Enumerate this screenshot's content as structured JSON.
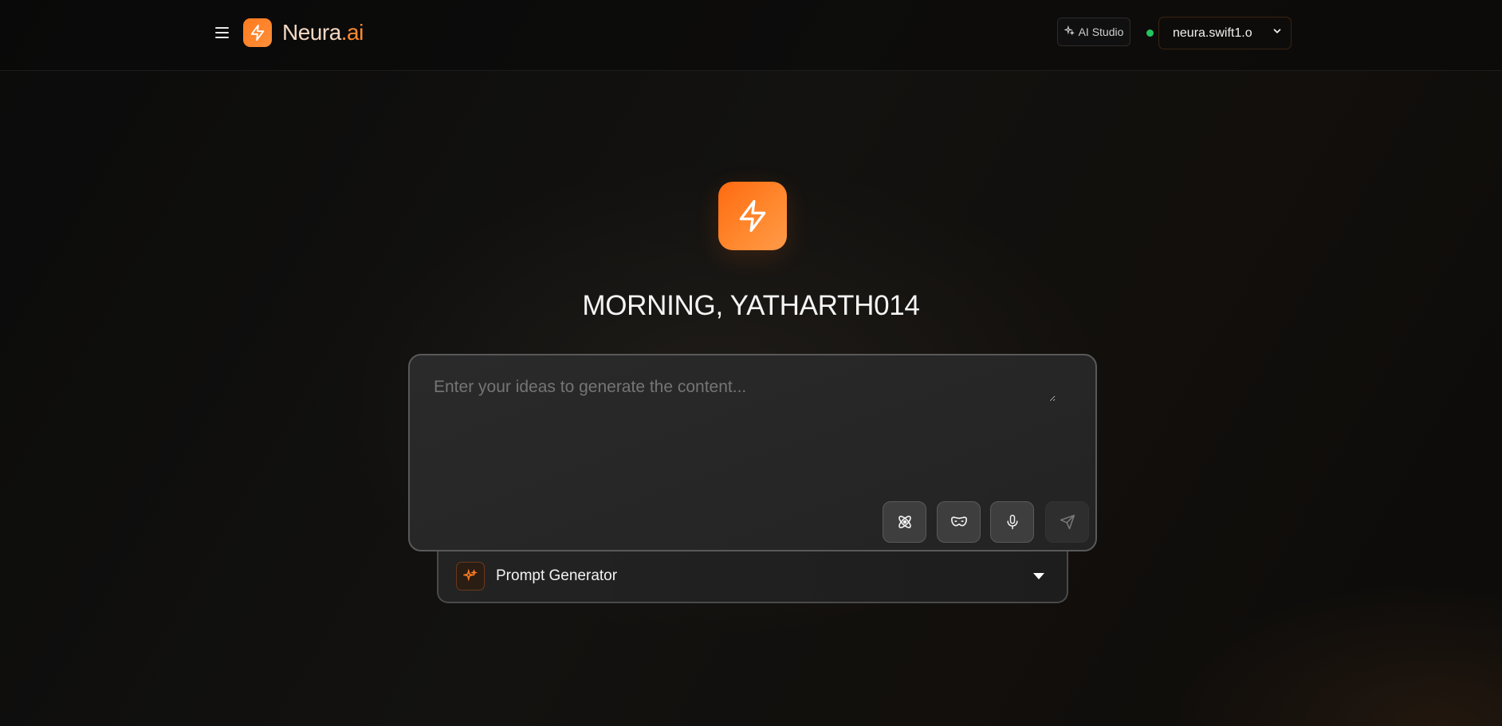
{
  "header": {
    "brand": {
      "name_part1": "Neura",
      "name_part2": ".ai",
      "logo_icon": "lightning-bolt-icon"
    },
    "menu_icon": "hamburger-menu-icon",
    "studio_button": {
      "label": "AI Studio",
      "icon": "sparkles-icon"
    },
    "status": {
      "state": "online",
      "color": "#22c55e"
    },
    "model_select": {
      "value": "neura.swift1.o"
    }
  },
  "hero": {
    "logo_icon": "lightning-bolt-icon",
    "greeting": "MORNING, YATHARTH014"
  },
  "prompt": {
    "placeholder": "Enter your ideas to generate the content...",
    "value": "",
    "tools": [
      {
        "name": "atom-icon"
      },
      {
        "name": "mask-icon"
      },
      {
        "name": "microphone-icon"
      },
      {
        "name": "send-icon"
      }
    ]
  },
  "generator": {
    "label": "Prompt Generator",
    "icon": "sparkles-icon"
  },
  "colors": {
    "accent": "#ff7a1f",
    "background": "#0e0d0c",
    "card": "#262626"
  }
}
